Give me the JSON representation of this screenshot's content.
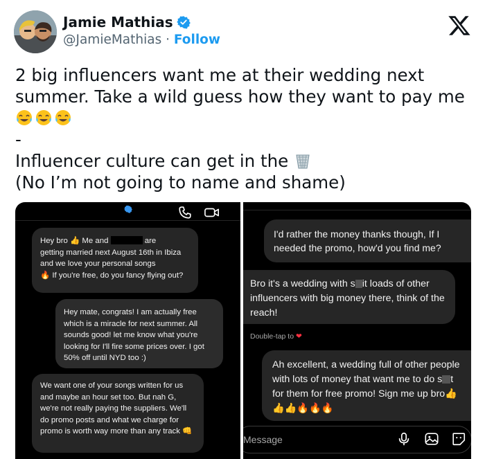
{
  "author": {
    "name": "Jamie Mathias",
    "handle": "@JamieMathias",
    "separator": " · ",
    "follow_label": "Follow"
  },
  "tweet": {
    "line1": "2 big influencers want me at their wedding next summer. Take a wild guess how they want to pay me",
    "dash": "-",
    "line2": "Influencer culture can get in the",
    "line3": "(No I’m not going to name and shame)"
  },
  "left_chat": {
    "bubble1": {
      "part1": "Hey bro",
      "part2": "Me and",
      "part3": "are",
      "part4": "getting married next August 16th in Ibiza and we love your personal songs",
      "part5": "If you're free, do you fancy flying out?"
    },
    "bubble2": "Hey mate, congrats! I am actually free which is a miracle for next summer. All sounds good! let me know what you're looking for I'll fire some prices over. I got 50% off until NYD too :)",
    "bubble3": "We want one of your songs written for us and maybe an hour set too. But nah G, we're not really paying the suppliers. We'll do promo posts and what we charge for promo is worth way more than any track"
  },
  "right_chat": {
    "bubble1": "I'd rather the money thanks though, If I needed the promo, how'd you find me?",
    "bubble2_a": "Bro it's a wedding with s",
    "bubble2_b": "it loads of other influencers with big money there, think of the reach!",
    "double_tap": "Double-tap to",
    "bubble3_a": "Ah excellent, a wedding full of other people with lots of money that want me to do s",
    "bubble3_b": "t for them for free promo! Sign me up bro",
    "message_placeholder": "Message"
  },
  "colors": {
    "link": "#1d9bf0",
    "bubble": "#262626",
    "panel_bg": "#000000",
    "heart": "#ff3040"
  }
}
